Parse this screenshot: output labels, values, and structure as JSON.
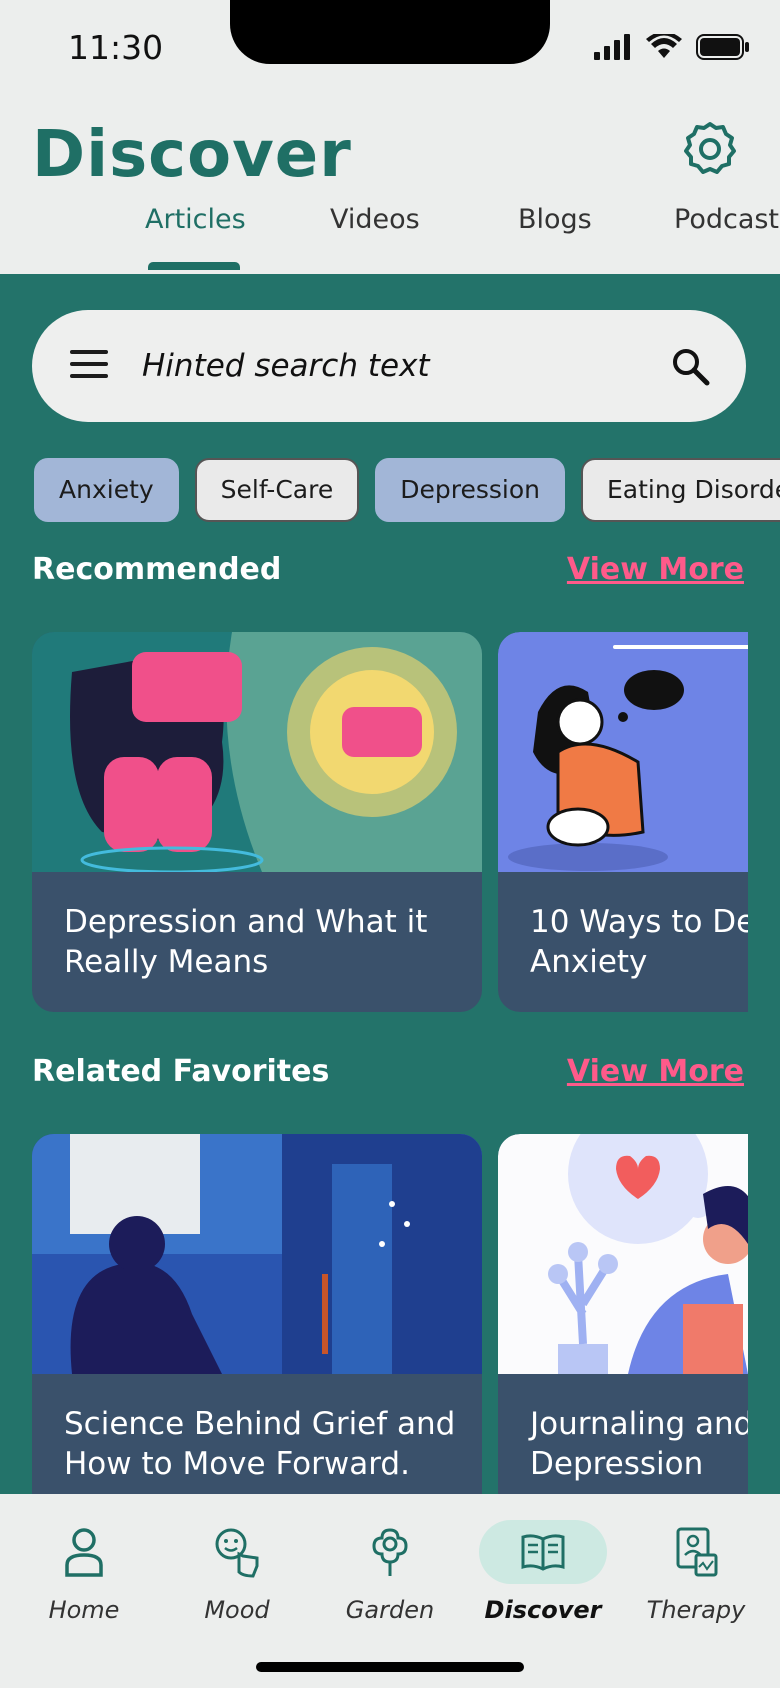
{
  "status_bar": {
    "time": "11:30"
  },
  "header": {
    "title": "Discover",
    "tabs": [
      {
        "label": "Articles",
        "active": true
      },
      {
        "label": "Videos",
        "active": false
      },
      {
        "label": "Blogs",
        "active": false
      },
      {
        "label": "Podcasts",
        "active": false
      }
    ]
  },
  "search": {
    "placeholder": "Hinted search text"
  },
  "chips": [
    {
      "label": "Anxiety",
      "selected": true
    },
    {
      "label": "Self-Care",
      "selected": false
    },
    {
      "label": "Depression",
      "selected": true
    },
    {
      "label": "Eating Disorders",
      "selected": false
    }
  ],
  "sections": {
    "recommended": {
      "title": "Recommended",
      "view_more": "View More",
      "cards": [
        {
          "title_line1": "Depression and What it",
          "title_line2": "Really Means"
        },
        {
          "title_line1": "10 Ways to De",
          "title_line2": "Anxiety"
        }
      ]
    },
    "related": {
      "title": "Related Favorites",
      "view_more": "View More",
      "cards": [
        {
          "title_line1": "Science Behind Grief and",
          "title_line2": "How to Move Forward."
        },
        {
          "title_line1": "Journaling and",
          "title_line2": "Depression"
        }
      ]
    }
  },
  "bottom_nav": [
    {
      "label": "Home",
      "icon": "person-icon",
      "active": false
    },
    {
      "label": "Mood",
      "icon": "mood-icon",
      "active": false
    },
    {
      "label": "Garden",
      "icon": "flower-icon",
      "active": false
    },
    {
      "label": "Discover",
      "icon": "book-icon",
      "active": true
    },
    {
      "label": "Therapy",
      "icon": "therapy-icon",
      "active": false
    }
  ],
  "colors": {
    "primary": "#1f6f65",
    "teal_background": "#23736a",
    "card_background": "#3a516b",
    "link_pink": "#ff5a8a",
    "chip_selected": "#a2b6d7"
  }
}
